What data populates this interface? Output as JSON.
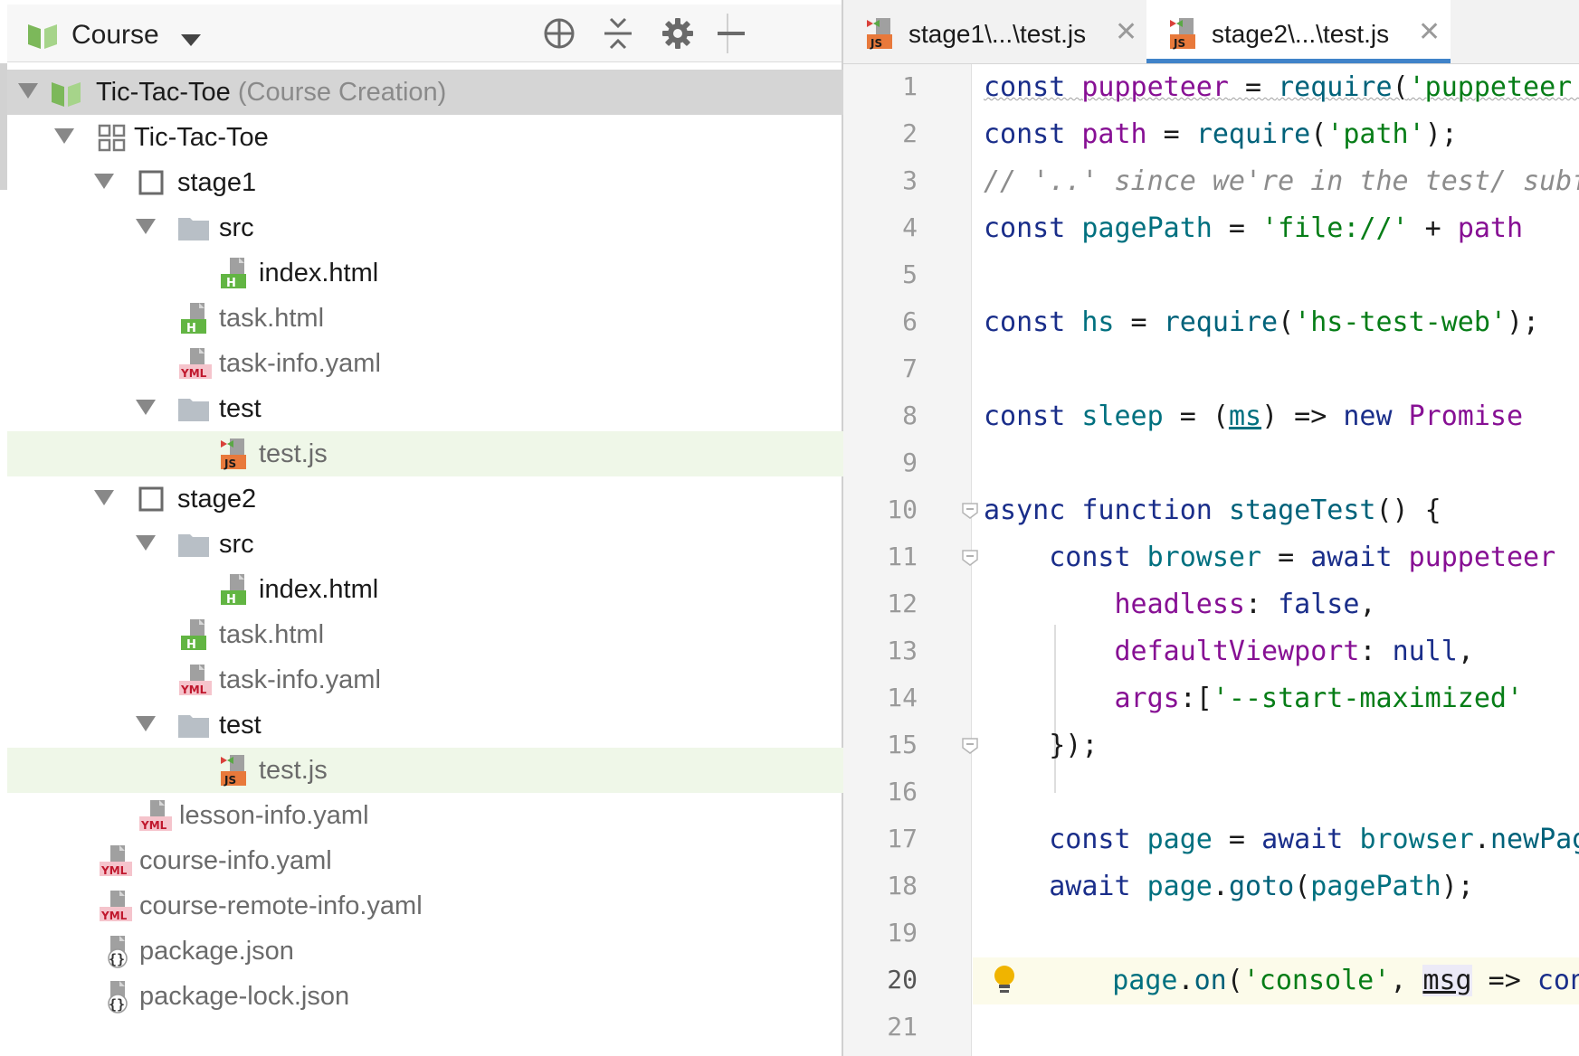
{
  "panel": {
    "title": "Course",
    "tree": [
      {
        "label": "Tic-Tac-Toe",
        "suffix": "(Course Creation)"
      },
      {
        "label": "Tic-Tac-Toe"
      },
      {
        "label": "stage1"
      },
      {
        "label": "src"
      },
      {
        "label": "index.html"
      },
      {
        "label": "task.html"
      },
      {
        "label": "task-info.yaml"
      },
      {
        "label": "test"
      },
      {
        "label": "test.js"
      },
      {
        "label": "stage2"
      },
      {
        "label": "src"
      },
      {
        "label": "index.html"
      },
      {
        "label": "task.html"
      },
      {
        "label": "task-info.yaml"
      },
      {
        "label": "test"
      },
      {
        "label": "test.js"
      },
      {
        "label": "lesson-info.yaml"
      },
      {
        "label": "course-info.yaml"
      },
      {
        "label": "course-remote-info.yaml"
      },
      {
        "label": "package.json"
      },
      {
        "label": "package-lock.json"
      }
    ]
  },
  "editor": {
    "tabs": [
      {
        "label": "stage1\\...\\test.js",
        "active": false
      },
      {
        "label": "stage2\\...\\test.js",
        "active": true
      }
    ],
    "current_line": 20,
    "lines": [
      {
        "n": "1",
        "tokens": [
          [
            "kw",
            "const "
          ],
          [
            "prop",
            "puppeteer"
          ],
          [
            "op",
            " = "
          ],
          [
            "fn",
            "require"
          ],
          [
            "op",
            "("
          ],
          [
            "str",
            "'puppeteer');"
          ]
        ]
      },
      {
        "n": "2",
        "tokens": [
          [
            "kw",
            "const "
          ],
          [
            "prop",
            "path"
          ],
          [
            "op",
            " = "
          ],
          [
            "fn",
            "require"
          ],
          [
            "op",
            "("
          ],
          [
            "str",
            "'path'"
          ],
          [
            "op",
            ");"
          ]
        ]
      },
      {
        "n": "3",
        "tokens": [
          [
            "cmt",
            "// '..' since we're in the test/ subfolder"
          ]
        ]
      },
      {
        "n": "4",
        "tokens": [
          [
            "kw",
            "const "
          ],
          [
            "id",
            "pagePath"
          ],
          [
            "op",
            " = "
          ],
          [
            "str",
            "'file://'"
          ],
          [
            "op",
            " + "
          ],
          [
            "prop",
            "path"
          ]
        ]
      },
      {
        "n": "5",
        "tokens": []
      },
      {
        "n": "6",
        "tokens": [
          [
            "kw",
            "const "
          ],
          [
            "id",
            "hs"
          ],
          [
            "op",
            " = "
          ],
          [
            "fn",
            "require"
          ],
          [
            "op",
            "("
          ],
          [
            "str",
            "'hs-test-web'"
          ],
          [
            "op",
            ");"
          ]
        ]
      },
      {
        "n": "7",
        "tokens": []
      },
      {
        "n": "8",
        "tokens": [
          [
            "kw",
            "const "
          ],
          [
            "id",
            "sleep"
          ],
          [
            "op",
            " = ("
          ],
          [
            "id",
            "ms"
          ],
          [
            "op",
            ") => "
          ],
          [
            "kw",
            "new "
          ],
          [
            "prop",
            "Promise"
          ]
        ]
      },
      {
        "n": "9",
        "tokens": []
      },
      {
        "n": "10",
        "tokens": [
          [
            "kw",
            "async function "
          ],
          [
            "fn",
            "stageTest"
          ],
          [
            "op",
            "() {"
          ]
        ]
      },
      {
        "n": "11",
        "tokens": [
          [
            "op",
            "    "
          ],
          [
            "kw",
            "const "
          ],
          [
            "id",
            "browser"
          ],
          [
            "op",
            " = "
          ],
          [
            "kw",
            "await "
          ],
          [
            "prop",
            "puppeteer"
          ]
        ]
      },
      {
        "n": "12",
        "tokens": [
          [
            "op",
            "        "
          ],
          [
            "prop",
            "headless"
          ],
          [
            "op",
            ": "
          ],
          [
            "kw",
            "false"
          ],
          [
            "op",
            ","
          ]
        ]
      },
      {
        "n": "13",
        "tokens": [
          [
            "op",
            "        "
          ],
          [
            "prop",
            "defaultViewport"
          ],
          [
            "op",
            ": "
          ],
          [
            "kw",
            "null"
          ],
          [
            "op",
            ","
          ]
        ]
      },
      {
        "n": "14",
        "tokens": [
          [
            "op",
            "        "
          ],
          [
            "prop",
            "args"
          ],
          [
            "op",
            ":["
          ],
          [
            "str",
            "'--start-maximized'"
          ]
        ]
      },
      {
        "n": "15",
        "tokens": [
          [
            "op",
            "    });"
          ]
        ]
      },
      {
        "n": "16",
        "tokens": []
      },
      {
        "n": "17",
        "tokens": [
          [
            "op",
            "    "
          ],
          [
            "kw",
            "const "
          ],
          [
            "id",
            "page"
          ],
          [
            "op",
            " = "
          ],
          [
            "kw",
            "await "
          ],
          [
            "id",
            "browser"
          ],
          [
            "op",
            "."
          ],
          [
            "fn",
            "newPage"
          ]
        ]
      },
      {
        "n": "18",
        "tokens": [
          [
            "op",
            "    "
          ],
          [
            "kw",
            "await "
          ],
          [
            "id",
            "page"
          ],
          [
            "op",
            "."
          ],
          [
            "fn",
            "goto"
          ],
          [
            "op",
            "("
          ],
          [
            "id",
            "pagePath"
          ],
          [
            "op",
            ");"
          ]
        ]
      },
      {
        "n": "19",
        "tokens": []
      },
      {
        "n": "20",
        "tokens": [
          [
            "op",
            "    "
          ],
          [
            "id",
            "page"
          ],
          [
            "op",
            "."
          ],
          [
            "fn",
            "on"
          ],
          [
            "op",
            "("
          ],
          [
            "str",
            "'console'"
          ],
          [
            "op",
            ", "
          ],
          [
            "op",
            "msg"
          ],
          [
            "op",
            " => "
          ],
          [
            "kw",
            "console"
          ]
        ]
      },
      {
        "n": "21",
        "tokens": []
      }
    ]
  }
}
